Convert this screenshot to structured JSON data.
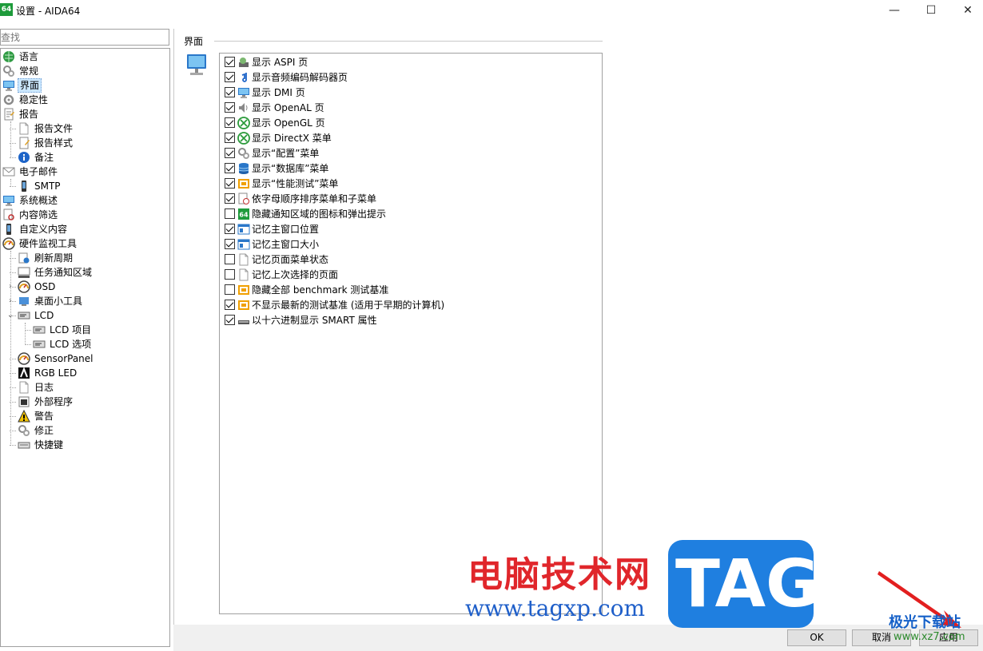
{
  "window": {
    "app_icon_label": "64",
    "title": "设置 - AIDA64",
    "minimize": "—",
    "maximize": "☐",
    "close": "✕"
  },
  "search": {
    "placeholder": "查找"
  },
  "tree": [
    {
      "label": "语言",
      "icon": "globe-icon",
      "level": 0
    },
    {
      "label": "常规",
      "icon": "gears-icon",
      "level": 0
    },
    {
      "label": "界面",
      "icon": "monitor-icon",
      "level": 0,
      "selected": true
    },
    {
      "label": "稳定性",
      "icon": "gear-icon",
      "level": 0
    },
    {
      "label": "报告",
      "icon": "report-icon",
      "level": 0
    },
    {
      "label": "报告文件",
      "icon": "document-icon",
      "level": 1
    },
    {
      "label": "报告样式",
      "icon": "report-style-icon",
      "level": 1
    },
    {
      "label": "备注",
      "icon": "info-icon",
      "level": 1
    },
    {
      "label": "电子邮件",
      "icon": "email-icon",
      "level": 0
    },
    {
      "label": "SMTP",
      "icon": "phone-icon",
      "level": 1
    },
    {
      "label": "系统概述",
      "icon": "monitor-icon",
      "level": 0
    },
    {
      "label": "内容筛选",
      "icon": "filter-icon",
      "level": 0
    },
    {
      "label": "自定义内容",
      "icon": "phone-icon",
      "level": 0
    },
    {
      "label": "硬件监视工具",
      "icon": "gauge-icon",
      "level": 0
    },
    {
      "label": "刷新周期",
      "icon": "refresh-icon",
      "level": 1
    },
    {
      "label": "任务通知区域",
      "icon": "taskbar-icon",
      "level": 1
    },
    {
      "label": "OSD",
      "icon": "gauge-icon",
      "level": 1,
      "expander": "›"
    },
    {
      "label": "桌面小工具",
      "icon": "gadget-icon",
      "level": 1,
      "expander": "›"
    },
    {
      "label": "LCD",
      "icon": "lcd-icon",
      "level": 1,
      "expander": "⌄"
    },
    {
      "label": "LCD 项目",
      "icon": "lcd-icon",
      "level": 2
    },
    {
      "label": "LCD 选项",
      "icon": "lcd-icon",
      "level": 2
    },
    {
      "label": "SensorPanel",
      "icon": "gauge-icon",
      "level": 1
    },
    {
      "label": "RGB LED",
      "icon": "rgb-icon",
      "level": 1
    },
    {
      "label": "日志",
      "icon": "document-icon",
      "level": 1
    },
    {
      "label": "外部程序",
      "icon": "program-icon",
      "level": 1
    },
    {
      "label": "警告",
      "icon": "warning-icon",
      "level": 1
    },
    {
      "label": "修正",
      "icon": "gears-icon",
      "level": 1
    },
    {
      "label": "快捷键",
      "icon": "keyboard-icon",
      "level": 1
    }
  ],
  "section": {
    "title": "界面"
  },
  "options": [
    {
      "label": "显示 ASPI 页",
      "checked": true,
      "icon": "aspi-icon"
    },
    {
      "label": "显示音频编码解码器页",
      "checked": true,
      "icon": "music-note-icon"
    },
    {
      "label": "显示 DMI 页",
      "checked": true,
      "icon": "monitor-icon"
    },
    {
      "label": "显示 OpenAL 页",
      "checked": true,
      "icon": "speaker-icon"
    },
    {
      "label": "显示 OpenGL 页",
      "checked": true,
      "icon": "xbox-icon"
    },
    {
      "label": "显示 DirectX 菜单",
      "checked": true,
      "icon": "xbox-icon"
    },
    {
      "label": "显示“配置”菜单",
      "checked": true,
      "icon": "gears-icon"
    },
    {
      "label": "显示“数据库”菜单",
      "checked": true,
      "icon": "database-icon"
    },
    {
      "label": "显示“性能测试”菜单",
      "checked": true,
      "icon": "benchmark-icon"
    },
    {
      "label": "依字母顺序排序菜单和子菜单",
      "checked": true,
      "icon": "sort-icon"
    },
    {
      "label": "隐藏通知区域的图标和弹出提示",
      "checked": false,
      "icon": "aida64-icon"
    },
    {
      "label": "记忆主窗口位置",
      "checked": true,
      "icon": "window-icon"
    },
    {
      "label": "记忆主窗口大小",
      "checked": true,
      "icon": "window-icon"
    },
    {
      "label": "记忆页面菜单状态",
      "checked": false,
      "icon": "document-icon"
    },
    {
      "label": "记忆上次选择的页面",
      "checked": false,
      "icon": "document-icon"
    },
    {
      "label": "隐藏全部 benchmark 测试基准",
      "checked": false,
      "icon": "benchmark-icon"
    },
    {
      "label": "不显示最新的测试基准 (适用于早期的计算机)",
      "checked": true,
      "icon": "benchmark-icon"
    },
    {
      "label": "以十六进制显示 SMART 属性",
      "checked": true,
      "icon": "drive-icon"
    }
  ],
  "buttons": {
    "ok": "OK",
    "cancel": "取消",
    "apply": "应用"
  },
  "watermark": {
    "cn": "电脑技术网",
    "url": "www.tagxp.com",
    "tag": "TAG",
    "logo_text": "极光下载站",
    "logo_url": "www.xz7.com"
  }
}
